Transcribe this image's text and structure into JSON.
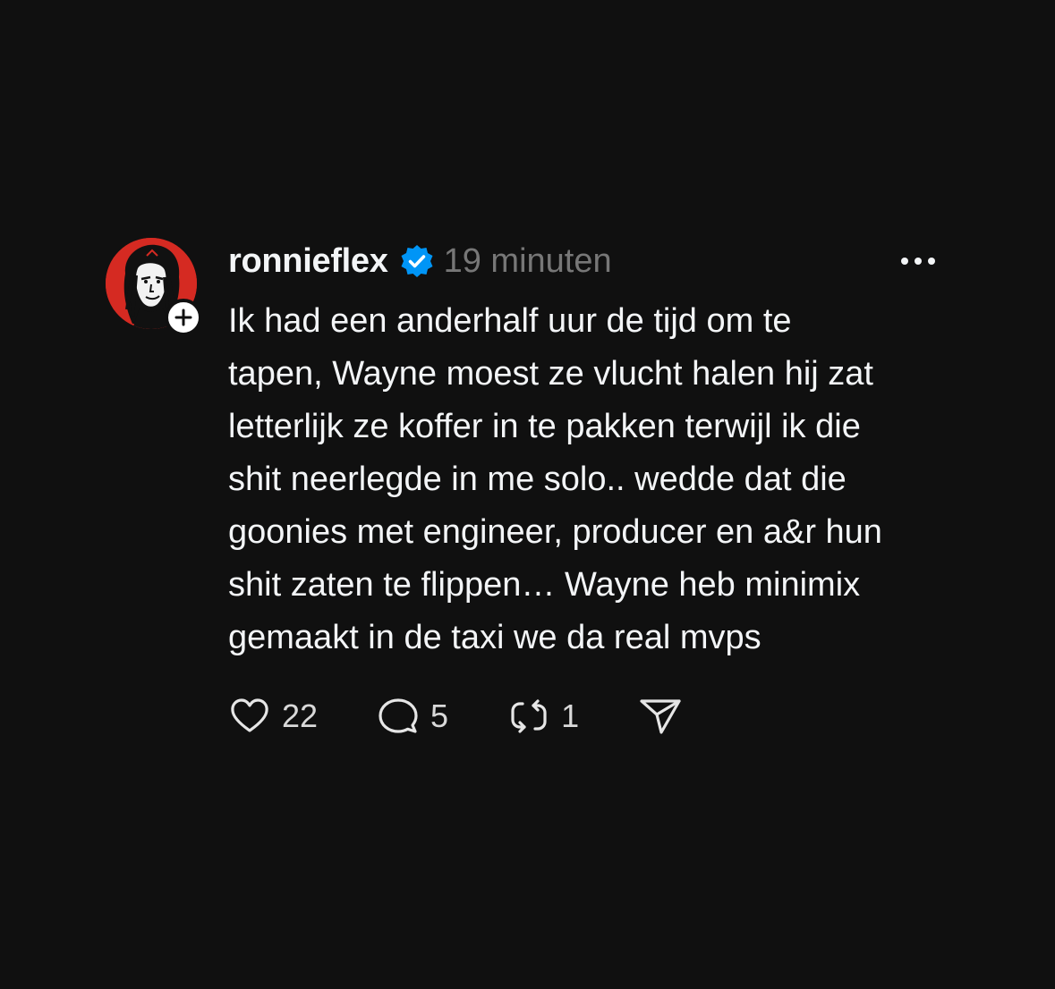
{
  "post": {
    "username": "ronnieflex",
    "timestamp": "19 minuten",
    "text": "Ik had een anderhalf uur de tijd om te\ntapen, Wayne moest ze vlucht halen hij zat\nletterlijk ze koffer in te pakken terwijl ik die\nshit neerlegde in me solo.. wedde dat die\ngoonies met engineer, producer en a&r hun\nshit zaten te flippen… Wayne heb minimix\ngemaakt in de taxi we da real mvps",
    "verified": true,
    "avatar_bg_color": "#d52a22",
    "verified_color": "#0095f6"
  },
  "actions": {
    "likes": "22",
    "comments": "5",
    "reposts": "1"
  },
  "icons": {
    "like": "heart-icon",
    "comment": "comment-bubble-icon",
    "repost": "repost-icon",
    "share": "send-icon",
    "more": "more-dots-icon",
    "follow": "plus-icon",
    "verified": "verified-badge-icon"
  }
}
